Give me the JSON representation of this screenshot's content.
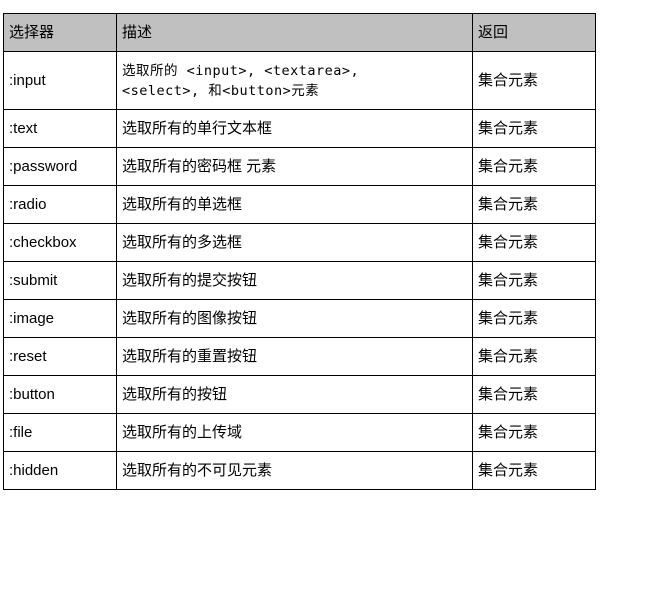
{
  "table": {
    "headers": {
      "selector": "选择器",
      "description": "描述",
      "returns": "返回"
    },
    "rows": [
      {
        "selector": ":input",
        "description": "选取所的 <input>, <textarea>, <select>, 和<button>元素",
        "description_line1": "选取所的 <input>, <textarea>,",
        "description_line2": "<select>, 和<button>元素",
        "returns": "集合元素"
      },
      {
        "selector": ":text",
        "description": "选取所有的单行文本框",
        "returns": "集合元素"
      },
      {
        "selector": ":password",
        "description": "选取所有的密码框 元素",
        "returns": "集合元素"
      },
      {
        "selector": ":radio",
        "description": "选取所有的单选框",
        "returns": "集合元素"
      },
      {
        "selector": ":checkbox",
        "description": "选取所有的多选框",
        "returns": "集合元素"
      },
      {
        "selector": ":submit",
        "description": "选取所有的提交按钮",
        "returns": "集合元素"
      },
      {
        "selector": ":image",
        "description": "选取所有的图像按钮",
        "returns": "集合元素"
      },
      {
        "selector": ":reset",
        "description": "选取所有的重置按钮",
        "returns": "集合元素"
      },
      {
        "selector": ":button",
        "description": "选取所有的按钮",
        "returns": "集合元素"
      },
      {
        "selector": ":file",
        "description": "选取所有的上传域",
        "returns": "集合元素"
      },
      {
        "selector": ":hidden",
        "description": "选取所有的不可见元素",
        "returns": "集合元素"
      }
    ],
    "colors": {
      "header_background": "#c0c0c0",
      "body_background": "#ffffff",
      "border": "#000000",
      "text": "#000000"
    }
  }
}
